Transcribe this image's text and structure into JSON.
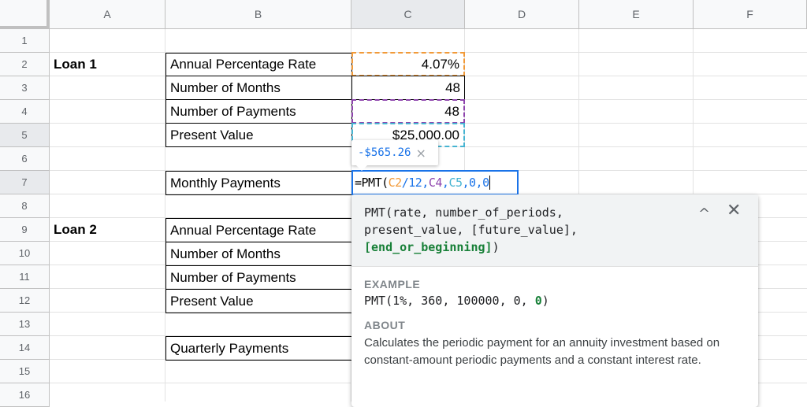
{
  "columns": [
    "A",
    "B",
    "C",
    "D",
    "E",
    "F"
  ],
  "rows": [
    "1",
    "2",
    "3",
    "4",
    "5",
    "6",
    "7",
    "8",
    "9",
    "10",
    "11",
    "12",
    "13",
    "14",
    "15",
    "16"
  ],
  "cells": {
    "A2": "Loan 1",
    "B2": "Annual Percentage Rate",
    "C2": "4.07%",
    "B3": "Number of Months",
    "C3": "48",
    "B4": "Number of Payments",
    "C4": "48",
    "B5": "Present Value",
    "C5": "$25,000.00",
    "B7": "Monthly Payments",
    "A9": "Loan 2",
    "B9": "Annual Percentage Rate",
    "B10": "Number of Months",
    "B11": "Number of Payments",
    "B12": "Present Value",
    "B14": "Quarterly Payments"
  },
  "editor": {
    "parts": [
      "=PMT(",
      "C2",
      "/12,",
      "C4",
      ",",
      "C5",
      ",0,0"
    ],
    "colors": {
      "c2": "#f29a38",
      "c4": "#8e44ad",
      "c5": "#46b4d2",
      "num": "#1a73e8"
    }
  },
  "preview": {
    "value": "-$565.26",
    "close": "×"
  },
  "help": {
    "sig1": "PMT(rate, number_of_periods,",
    "sig2": "present_value, [future_value],",
    "sig3": "[end_or_beginning]",
    "sig4": ")",
    "example_label": "EXAMPLE",
    "example_a": "PMT(1%, 360, 100000, 0, ",
    "example_b": "0",
    "example_c": ")",
    "about_label": "ABOUT",
    "about": "Calculates the periodic payment for an annuity investment based on constant-amount periodic payments and a constant interest rate.",
    "collapse": "^",
    "close": "✕"
  }
}
